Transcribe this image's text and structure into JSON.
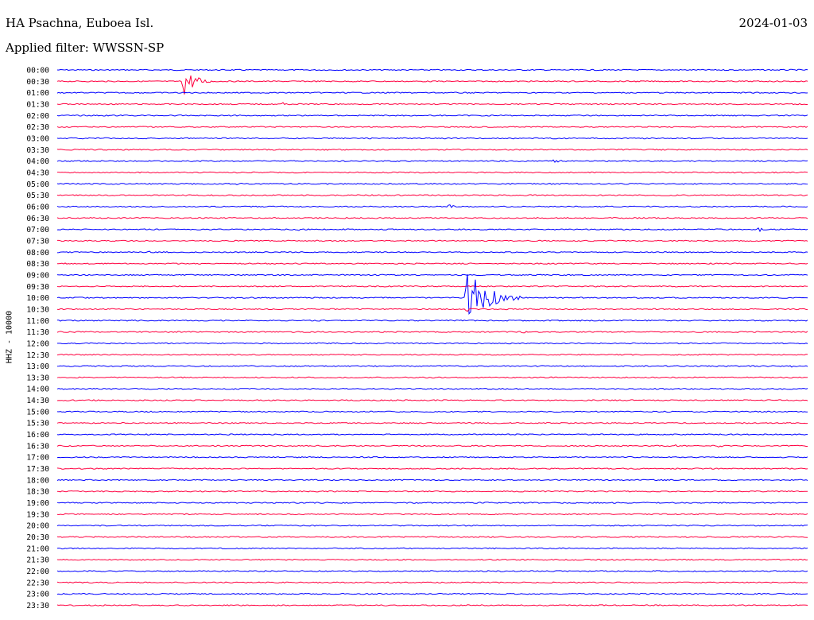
{
  "header": {
    "station": "HA Psachna, Euboea Isl.",
    "date": "2024-01-03",
    "filter": "Applied filter: WWSSN-SP"
  },
  "channel_label": "HHZ - 10000",
  "colors": {
    "even_trace": "#0000ff",
    "odd_trace": "#ff0040"
  },
  "chart_data": {
    "type": "line",
    "chart_kind": "helicorder",
    "grid": false,
    "rows": [
      {
        "label": "00:00",
        "color": "blue",
        "events": []
      },
      {
        "label": "00:30",
        "color": "red",
        "events": [
          {
            "t": 0.168,
            "amp": 20,
            "dur": 0.015
          }
        ]
      },
      {
        "label": "01:00",
        "color": "blue",
        "events": []
      },
      {
        "label": "01:30",
        "color": "red",
        "events": [
          {
            "t": 0.3,
            "amp": 2.5,
            "dur": 0.005
          }
        ]
      },
      {
        "label": "02:00",
        "color": "blue",
        "events": []
      },
      {
        "label": "02:30",
        "color": "red",
        "events": []
      },
      {
        "label": "03:00",
        "color": "blue",
        "events": []
      },
      {
        "label": "03:30",
        "color": "red",
        "events": []
      },
      {
        "label": "04:00",
        "color": "blue",
        "events": [
          {
            "t": 0.66,
            "amp": 4,
            "dur": 0.008
          }
        ]
      },
      {
        "label": "04:30",
        "color": "red",
        "events": []
      },
      {
        "label": "05:00",
        "color": "blue",
        "events": [
          {
            "t": 0.24,
            "amp": 2.5,
            "dur": 0.005
          }
        ]
      },
      {
        "label": "05:30",
        "color": "red",
        "events": []
      },
      {
        "label": "06:00",
        "color": "blue",
        "events": [
          {
            "t": 0.52,
            "amp": 3,
            "dur": 0.015
          }
        ]
      },
      {
        "label": "06:30",
        "color": "red",
        "events": []
      },
      {
        "label": "07:00",
        "color": "blue",
        "events": [
          {
            "t": 0.32,
            "amp": 2.5,
            "dur": 0.004
          },
          {
            "t": 0.935,
            "amp": 5,
            "dur": 0.004
          }
        ]
      },
      {
        "label": "07:30",
        "color": "red",
        "events": []
      },
      {
        "label": "08:00",
        "color": "blue",
        "events": [
          {
            "t": 0.12,
            "amp": 2.5,
            "dur": 0.004
          }
        ]
      },
      {
        "label": "08:30",
        "color": "red",
        "events": []
      },
      {
        "label": "09:00",
        "color": "blue",
        "events": []
      },
      {
        "label": "09:30",
        "color": "red",
        "events": [
          {
            "t": 0.14,
            "amp": 3,
            "dur": 0.008
          }
        ]
      },
      {
        "label": "10:00",
        "color": "blue",
        "events": [
          {
            "t": 0.545,
            "amp": 40,
            "dur": 0.025
          }
        ]
      },
      {
        "label": "10:30",
        "color": "red",
        "events": [
          {
            "t": 0.545,
            "amp": 4,
            "dur": 0.01
          }
        ]
      },
      {
        "label": "11:00",
        "color": "blue",
        "events": []
      },
      {
        "label": "11:30",
        "color": "red",
        "events": [
          {
            "t": 0.62,
            "amp": 2.5,
            "dur": 0.006
          }
        ]
      },
      {
        "label": "12:00",
        "color": "blue",
        "events": []
      },
      {
        "label": "12:30",
        "color": "red",
        "events": []
      },
      {
        "label": "13:00",
        "color": "blue",
        "events": [
          {
            "t": 0.98,
            "amp": 3,
            "dur": 0.004
          }
        ]
      },
      {
        "label": "13:30",
        "color": "red",
        "events": []
      },
      {
        "label": "14:00",
        "color": "blue",
        "events": []
      },
      {
        "label": "14:30",
        "color": "red",
        "events": [
          {
            "t": 0.11,
            "amp": 1.5,
            "dur": 0.01
          }
        ]
      },
      {
        "label": "15:00",
        "color": "blue",
        "events": []
      },
      {
        "label": "15:30",
        "color": "red",
        "events": []
      },
      {
        "label": "16:00",
        "color": "blue",
        "events": []
      },
      {
        "label": "16:30",
        "color": "red",
        "events": [
          {
            "t": 0.82,
            "amp": 2,
            "dur": 0.015
          },
          {
            "t": 0.88,
            "amp": 2,
            "dur": 0.01
          }
        ]
      },
      {
        "label": "17:00",
        "color": "blue",
        "events": []
      },
      {
        "label": "17:30",
        "color": "red",
        "events": []
      },
      {
        "label": "18:00",
        "color": "blue",
        "events": []
      },
      {
        "label": "18:30",
        "color": "red",
        "events": []
      },
      {
        "label": "19:00",
        "color": "blue",
        "events": []
      },
      {
        "label": "19:30",
        "color": "red",
        "events": [
          {
            "t": 0.395,
            "amp": 1.5,
            "dur": 0.004
          }
        ]
      },
      {
        "label": "20:00",
        "color": "blue",
        "events": [
          {
            "t": 0.45,
            "amp": 1.2,
            "dur": 0.006
          }
        ]
      },
      {
        "label": "20:30",
        "color": "red",
        "events": []
      },
      {
        "label": "21:00",
        "color": "blue",
        "events": []
      },
      {
        "label": "21:30",
        "color": "red",
        "events": []
      },
      {
        "label": "22:00",
        "color": "blue",
        "events": []
      },
      {
        "label": "22:30",
        "color": "red",
        "events": []
      },
      {
        "label": "23:00",
        "color": "blue",
        "events": [
          {
            "t": 0.91,
            "amp": 1.5,
            "dur": 0.004
          }
        ]
      },
      {
        "label": "23:30",
        "color": "red",
        "events": []
      }
    ]
  }
}
